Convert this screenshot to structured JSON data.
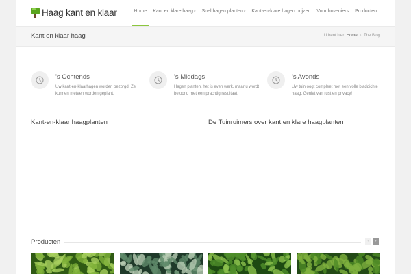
{
  "header": {
    "logo_text": "Haag kant en klaar",
    "nav": [
      {
        "label": "Home",
        "dropdown": false,
        "active": true
      },
      {
        "label": "Kant en klare haag",
        "dropdown": true,
        "active": false
      },
      {
        "label": "Snel hagen planten",
        "dropdown": true,
        "active": false
      },
      {
        "label": "Kant-en-klare hagen prijzen",
        "dropdown": false,
        "active": false
      },
      {
        "label": "Voor hoveniers",
        "dropdown": false,
        "active": false
      },
      {
        "label": "Producten",
        "dropdown": false,
        "active": false
      }
    ],
    "caret": "▾"
  },
  "titlebar": {
    "title": "Kant en klaar haag",
    "breadcrumb_prefix": "U bent hier:",
    "breadcrumb_home": "Home",
    "breadcrumb_sep": "›",
    "breadcrumb_current": "The Blog"
  },
  "features": [
    {
      "icon": "clock-icon",
      "title": "'s Ochtends",
      "text": "Uw kant-en-klaarhagen worden bezorgd. Ze kunnen meteen worden geplant."
    },
    {
      "icon": "clock-icon",
      "title": "'s Middags",
      "text": "Hagen planten, het is even werk, maar u wordt beloond met een prachtig resultaat."
    },
    {
      "icon": "clock-icon",
      "title": "'s Avonds",
      "text": "Uw tuin oogt compleet met een volle bladdichte haag. Geniet van rust en privacy!"
    }
  ],
  "sections": {
    "left": "Kant-en-klaar haagplanten",
    "right": "De Tuinruimers over kant en klare haagplanten",
    "products": "Producten"
  },
  "products_pager": {
    "prev": "‹",
    "next": "›"
  },
  "products": [
    {
      "name": "hedge-product-1",
      "palette": [
        "#2f5a14",
        "#7fb23a",
        "#a8cf5e"
      ]
    },
    {
      "name": "hedge-product-2",
      "palette": [
        "#1f3a2a",
        "#5f8a6a",
        "#b8cdb4"
      ]
    },
    {
      "name": "hedge-product-3",
      "palette": [
        "#1e4a12",
        "#4f8d2a",
        "#8cc04e"
      ]
    },
    {
      "name": "hedge-product-4",
      "palette": [
        "#234a16",
        "#4d8a26",
        "#7fb23e"
      ]
    }
  ],
  "colors": {
    "accent": "#8cc63f"
  }
}
